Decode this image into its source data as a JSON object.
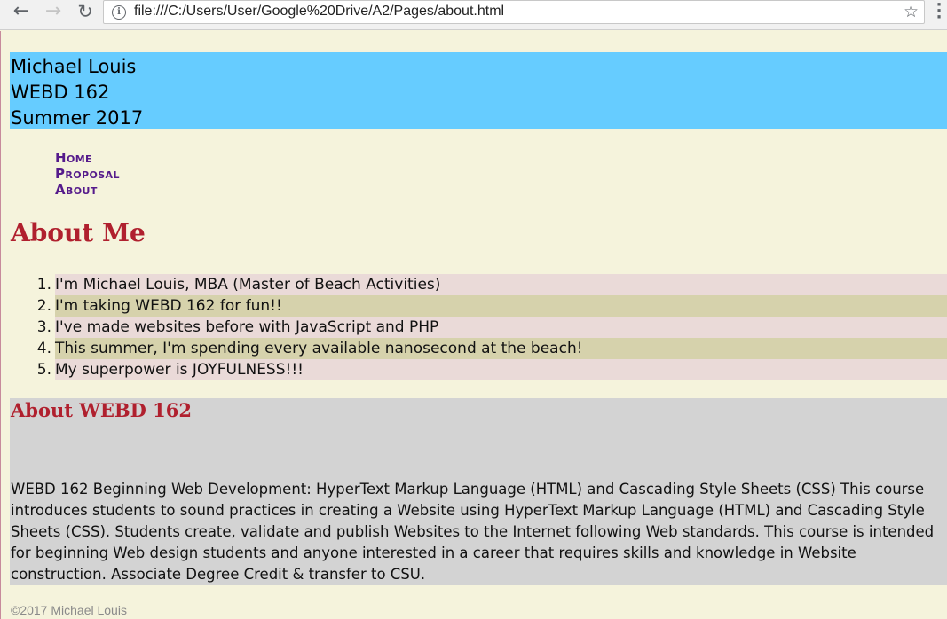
{
  "browser": {
    "url": "file:///C:/Users/User/Google%20Drive/A2/Pages/about.html"
  },
  "header": {
    "line1": "Michael Louis",
    "line2": "WEBD 162",
    "line3": "Summer 2017"
  },
  "nav": {
    "items": [
      "Home",
      "Proposal",
      "About"
    ]
  },
  "about": {
    "title": "About Me",
    "facts": [
      {
        "num": "1.",
        "text": "I'm Michael Louis, MBA (Master of Beach Activities)"
      },
      {
        "num": "2.",
        "text": "I'm taking WEBD 162 for fun!!"
      },
      {
        "num": "3.",
        "text": "I've made websites before with JavaScript and PHP"
      },
      {
        "num": "4.",
        "text": "This summer, I'm spending every available nanosecond at the beach!"
      },
      {
        "num": "5.",
        "text": "My superpower is JOYFULNESS!!!"
      }
    ]
  },
  "webd": {
    "title": "About WEBD 162",
    "description": "WEBD 162 Beginning Web Development: HyperText Markup Language (HTML) and Cascading Style Sheets (CSS) This course introduces students to sound practices in creating a Website using HyperText Markup Language (HTML) and Cascading Style Sheets (CSS). Students create, validate and publish Websites to the Internet following Web standards. This course is intended for beginning Web design students and anyone interested in a career that requires skills and knowledge in Website construction. Associate Degree Credit & transfer to CSU."
  },
  "footer": {
    "text": "©2017 Michael Louis"
  },
  "colors": {
    "header_bg": "#66ccff",
    "heading_red": "#b0202e",
    "nav_link": "#551a8b",
    "page_bg": "#f5f3dc",
    "row_odd": "#eadad8",
    "row_even": "#d6d2ac",
    "section_bg": "#d3d3d3"
  }
}
